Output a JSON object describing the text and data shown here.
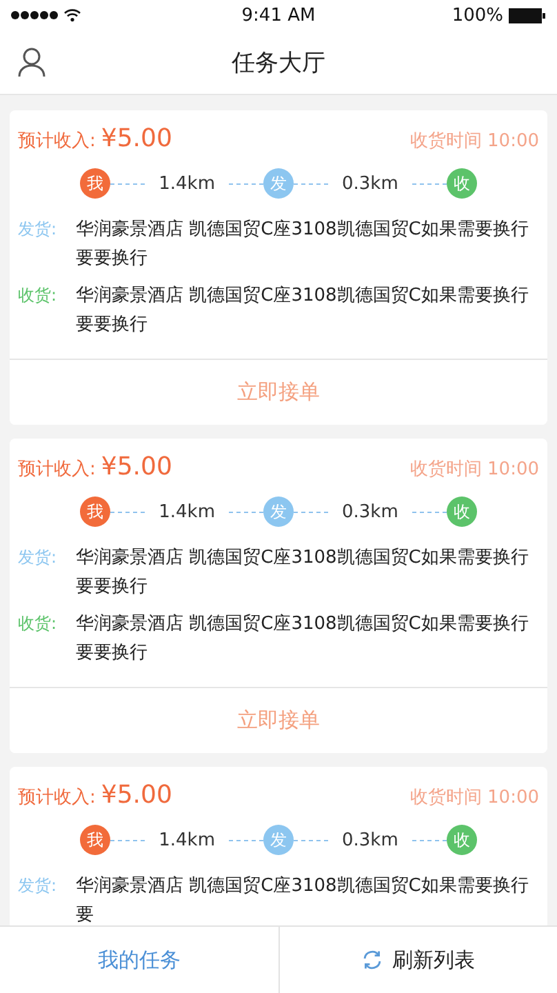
{
  "status_bar": {
    "time": "9:41 AM",
    "battery": "100%"
  },
  "nav": {
    "title": "任务大厅"
  },
  "tasks": [
    {
      "income_label": "预计收入:",
      "income": "¥5.00",
      "time_label": "收货时间 10:00",
      "route": {
        "me": "我",
        "dist1": "1.4km",
        "ship": "发",
        "dist2": "0.3km",
        "receive": "收"
      },
      "addresses": [
        {
          "kind": "ship",
          "label": "发货:",
          "text": "华润豪景酒店 凯德国贸C座3108凯德国贸C如果需要换行要要换行"
        },
        {
          "kind": "receive",
          "label": "收货:",
          "text": "华润豪景酒店 凯德国贸C座3108凯德国贸C如果需要换行要要换行"
        }
      ],
      "button": "立即接单"
    },
    {
      "income_label": "预计收入:",
      "income": "¥5.00",
      "time_label": "收货时间 10:00",
      "route": {
        "me": "我",
        "dist1": "1.4km",
        "ship": "发",
        "dist2": "0.3km",
        "receive": "收"
      },
      "addresses": [
        {
          "kind": "ship",
          "label": "发货:",
          "text": "华润豪景酒店 凯德国贸C座3108凯德国贸C如果需要换行要要换行"
        },
        {
          "kind": "receive",
          "label": "收货:",
          "text": "华润豪景酒店 凯德国贸C座3108凯德国贸C如果需要换行要要换行"
        }
      ],
      "button": "立即接单"
    },
    {
      "income_label": "预计收入:",
      "income": "¥5.00",
      "time_label": "收货时间 10:00",
      "route": {
        "me": "我",
        "dist1": "1.4km",
        "ship": "发",
        "dist2": "0.3km",
        "receive": "收"
      },
      "addresses": [
        {
          "kind": "ship",
          "label": "发货:",
          "text": "华润豪景酒店 凯德国贸C座3108凯德国贸C如果需要换行要"
        }
      ]
    }
  ],
  "footer": {
    "my_tasks": "我的任务",
    "refresh": "刷新列表"
  }
}
